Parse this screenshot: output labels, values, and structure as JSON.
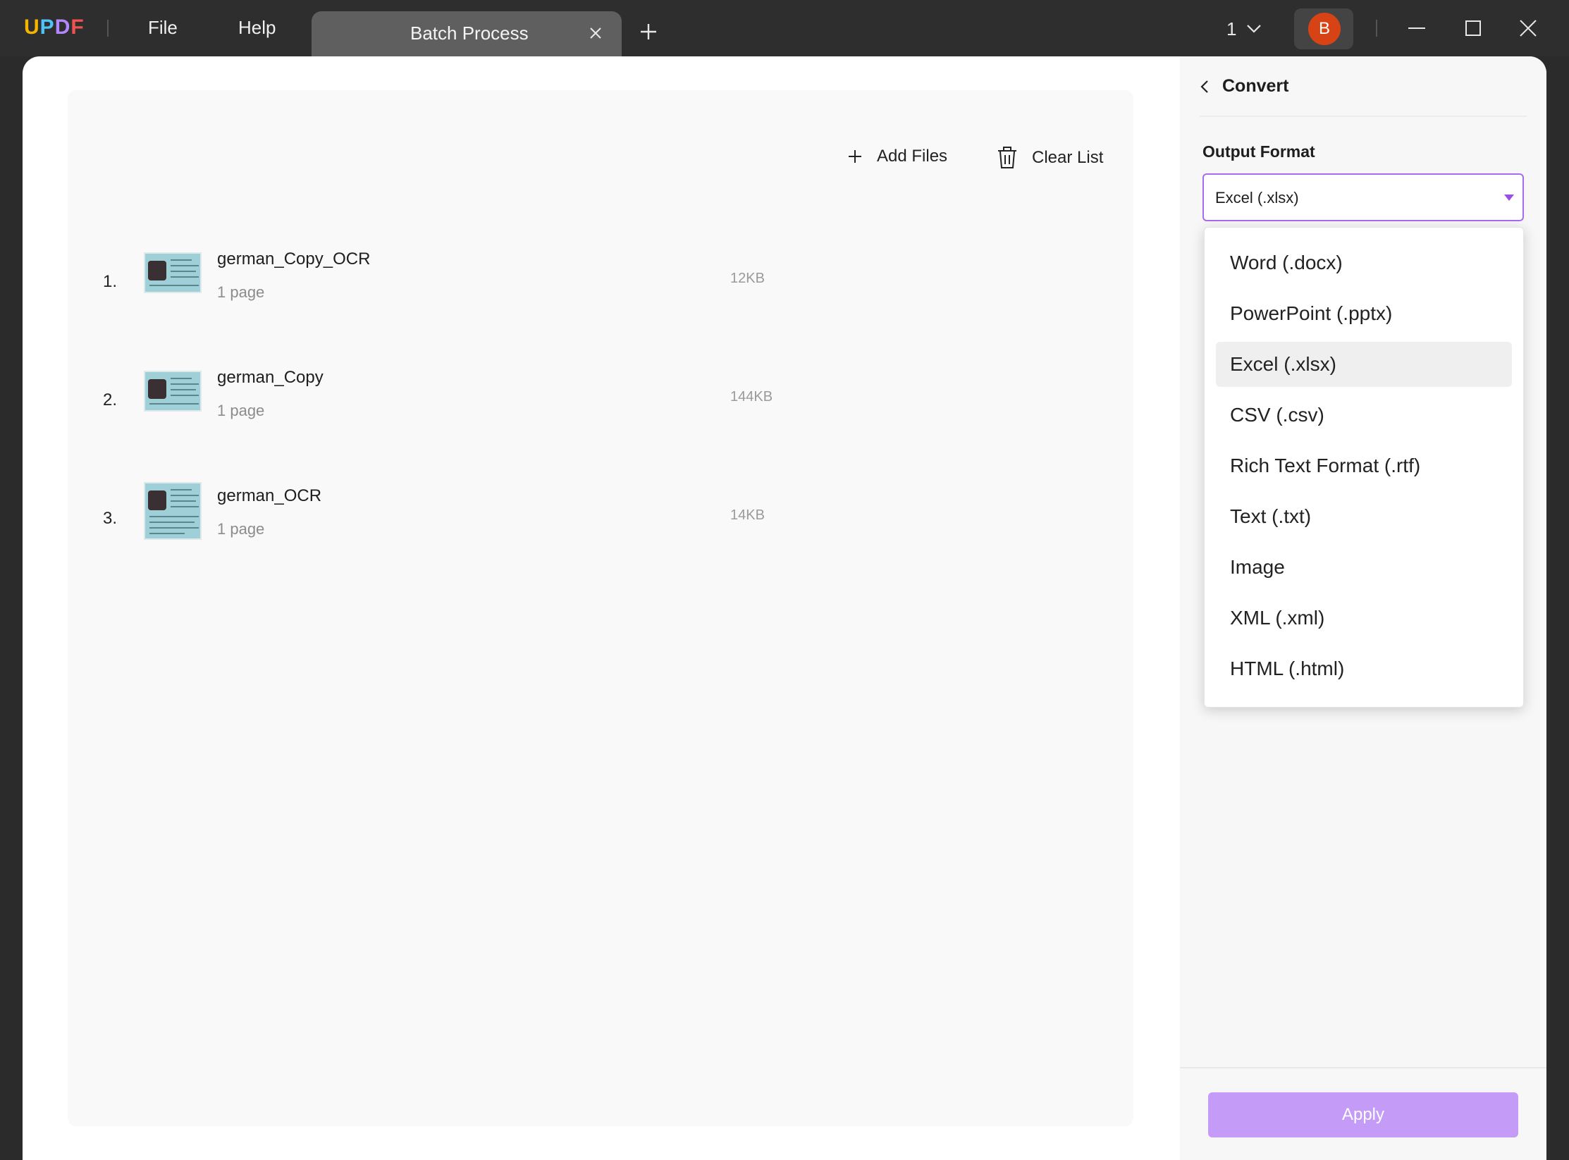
{
  "titlebar": {
    "logo": {
      "u": "U",
      "p": "P",
      "d": "D",
      "f": "F"
    },
    "menu": {
      "file": "File",
      "help": "Help"
    },
    "tab": {
      "label": "Batch Process"
    },
    "page_indicator": "1",
    "avatar_initial": "B"
  },
  "file_list": {
    "add_files": "Add Files",
    "clear_list": "Clear List",
    "files": [
      {
        "index": "1.",
        "name": "german_Copy_OCR",
        "pages": "1 page",
        "size": "12KB"
      },
      {
        "index": "2.",
        "name": "german_Copy",
        "pages": "1 page",
        "size": "144KB"
      },
      {
        "index": "3.",
        "name": "german_OCR",
        "pages": "1 page",
        "size": "14KB"
      }
    ]
  },
  "convert_panel": {
    "title": "Convert",
    "output_format_label": "Output Format",
    "selected_format": "Excel (.xlsx)",
    "apply_label": "Apply",
    "options": [
      "Word (.docx)",
      "PowerPoint (.pptx)",
      "Excel (.xlsx)",
      "CSV (.csv)",
      "Rich Text Format (.rtf)",
      "Text (.txt)",
      "Image",
      "XML (.xml)",
      "HTML (.html)"
    ]
  },
  "colors": {
    "accent": "#a56bf2",
    "apply_button": "#c49bf6",
    "avatar": "#d84315",
    "titlebar": "#2e2e2e"
  },
  "icons": [
    "plus-icon",
    "trash-icon",
    "chevron-left-icon",
    "chevron-down-icon",
    "close-icon",
    "minimize-icon",
    "maximize-icon"
  ]
}
